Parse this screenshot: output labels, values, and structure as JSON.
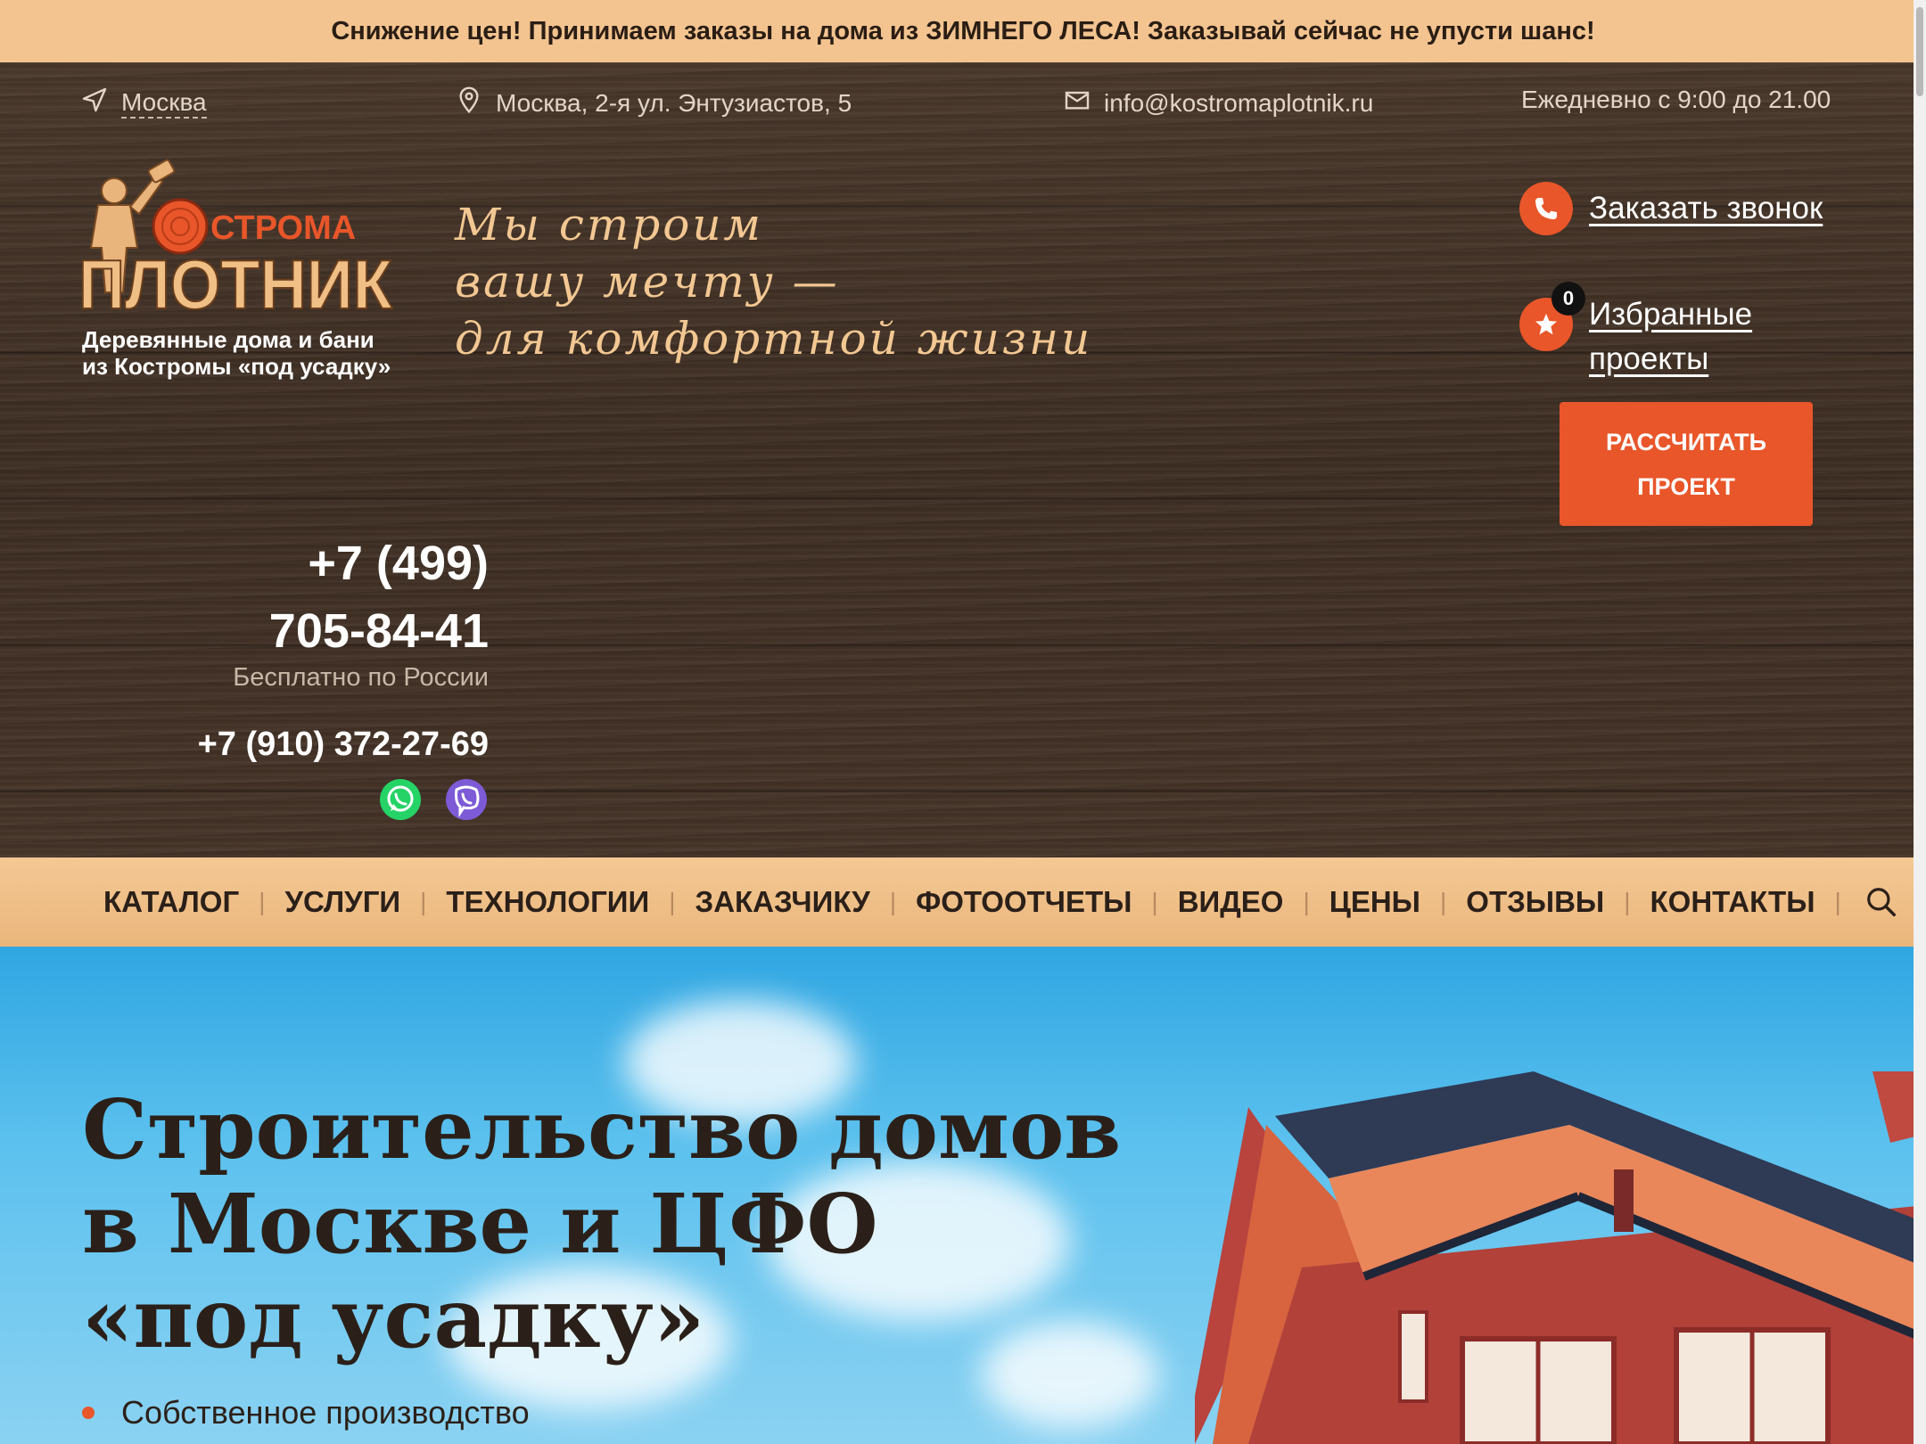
{
  "promo": {
    "text": "Снижение цен! Принимаем заказы на дома из ЗИМНЕГО ЛЕСА! Заказывай сейчас не упусти шанс!"
  },
  "topbar": {
    "city": "Москва",
    "address": "Москва, 2-я ул. Энтузиастов, 5",
    "email": "info@kostromaplotnik.ru",
    "hours": "Ежедневно с 9:00 до 21.00"
  },
  "logo": {
    "top_word": "СТРОМА",
    "main_word": "ПЛОТНИК",
    "subtitle_line1": "Деревянные дома и бани",
    "subtitle_line2": "из Костромы «под усадку»"
  },
  "slogan": {
    "line1": "Мы строим",
    "line2": "вашу мечту —",
    "line3": "для комфортной жизни"
  },
  "contacts": {
    "phone_main_line1": "+7 (499)",
    "phone_main_line2": "705-84-41",
    "phone_main_note": "Бесплатно по России",
    "phone_second": "+7 (910) 372-27-69"
  },
  "actions": {
    "callback_label": "Заказать звонок",
    "favorites_line1": "Избранные",
    "favorites_line2": "проекты",
    "favorites_count": "0",
    "calc_line1": "РАССЧИТАТЬ",
    "calc_line2": "ПРОЕКТ"
  },
  "nav": {
    "items": [
      "КАТАЛОГ",
      "УСЛУГИ",
      "ТЕХНОЛОГИИ",
      "ЗАКАЗЧИКУ",
      "ФОТООТЧЕТЫ",
      "ВИДЕО",
      "ЦЕНЫ",
      "ОТЗЫВЫ",
      "КОНТАКТЫ"
    ]
  },
  "hero": {
    "title_line1": "Строительство домов",
    "title_line2": "в Москве и ЦФО",
    "title_line3": "«под усадку»",
    "bullet1": "Собственное производство"
  },
  "colors": {
    "accent": "#e8562a",
    "promo_bg": "#f3c490",
    "slogan": "#f2c792",
    "nav_bg": "#eeba80",
    "dark_text": "#2b2019"
  }
}
